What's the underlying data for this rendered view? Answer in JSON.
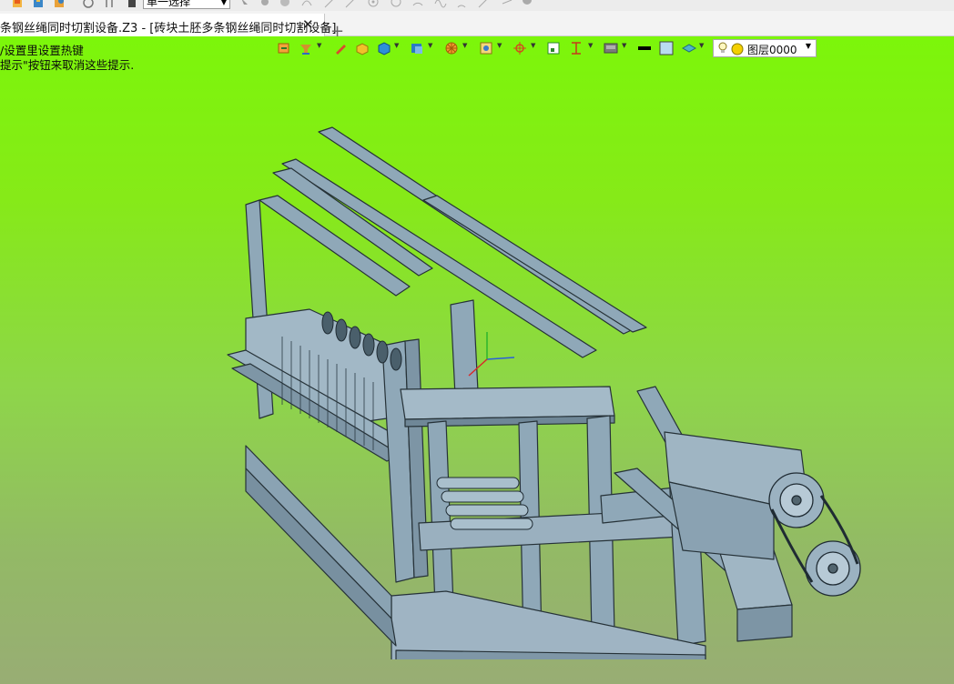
{
  "toolbar": {
    "selection_mode": "单一选择",
    "icons": [
      "new-file-icon",
      "save-icon",
      "export-icon",
      "undo-icon",
      "redo-icon",
      "stop-icon",
      "pick-icon",
      "sketch-icon",
      "play-icon",
      "curve-icon",
      "point-icon",
      "circle-icon",
      "arc-icon",
      "spline-icon",
      "line-icon",
      "trim-icon",
      "fillet-icon"
    ]
  },
  "tabs": {
    "active_tab_label": "条钢丝绳同时切割设备.Z3 - [砖块土胚多条钢丝绳同时切割设备]",
    "close_symbol": "✕",
    "new_tab_symbol": "+"
  },
  "viewport": {
    "hint_line1": "/设置里设置热键",
    "hint_line2": "提示\"按钮来取消这些提示.",
    "background_top": "#7cf60a",
    "background_bottom": "#98ad74",
    "model_color": "#8fa8b8"
  },
  "view_toolbar": {
    "icons": [
      "view-orient-icon",
      "filter-icon",
      "pen-icon",
      "box-yellow-icon",
      "cube-blue-icon",
      "cube-shade-icon",
      "wheel-icon",
      "section-icon",
      "axis-icon",
      "fit-icon",
      "dimension-icon",
      "display-icon",
      "line-color-icon",
      "fill-color-icon",
      "layer-stack-icon"
    ],
    "layer_label": "图层0000"
  }
}
